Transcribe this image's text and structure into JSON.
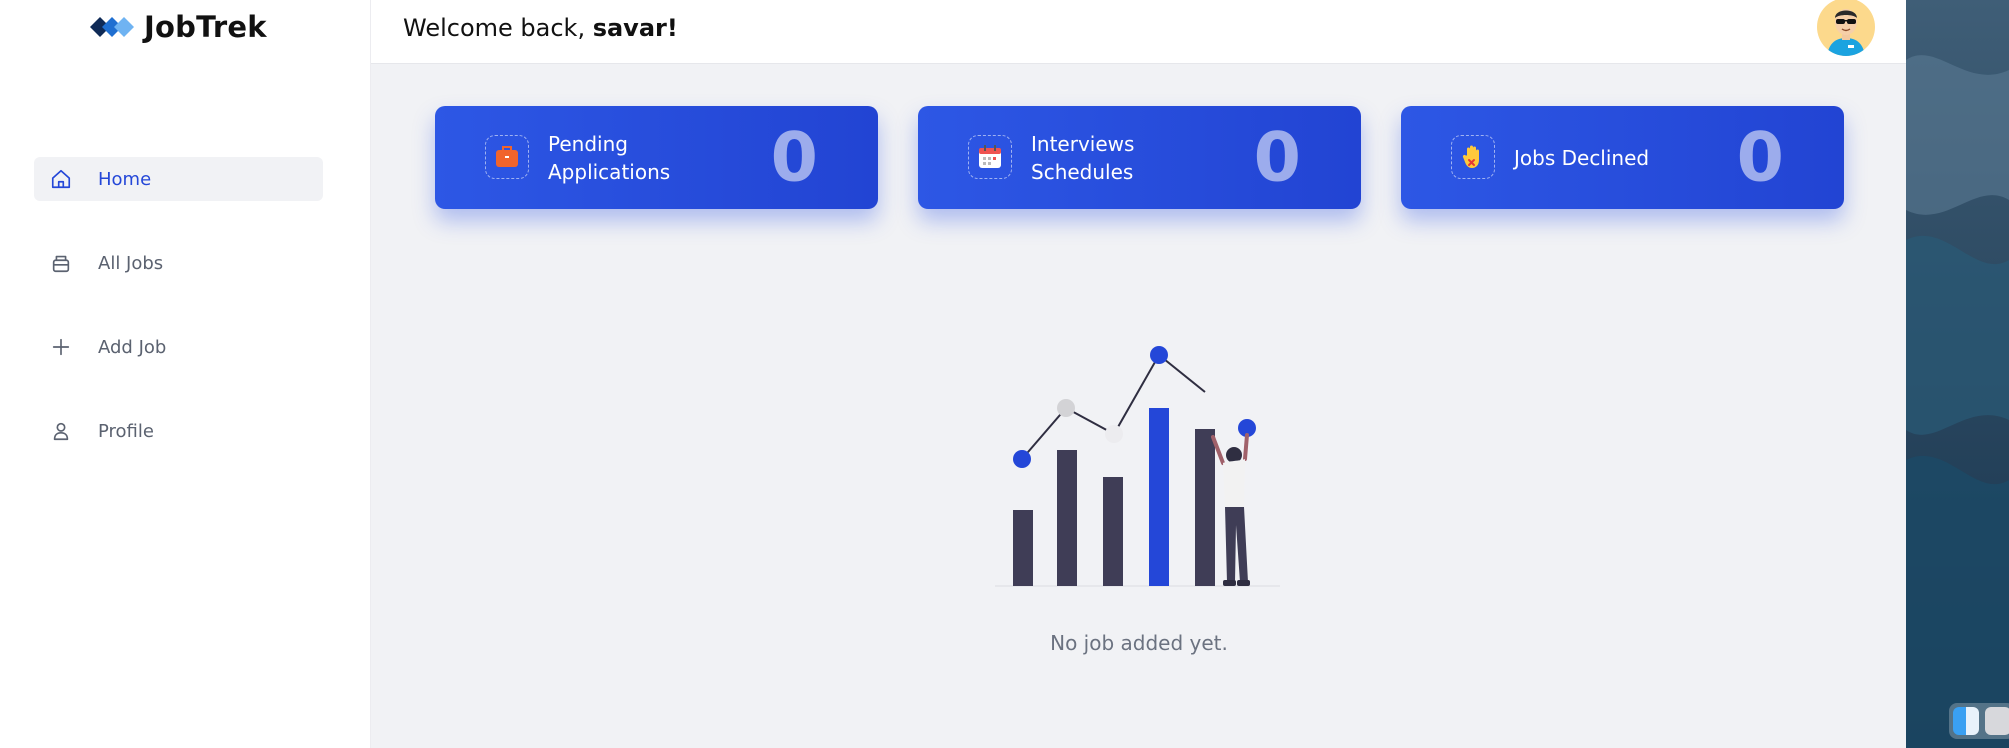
{
  "app": {
    "name": "JobTrek"
  },
  "sidebar": {
    "items": [
      {
        "label": "Home",
        "icon": "home-icon",
        "active": true
      },
      {
        "label": "All Jobs",
        "icon": "briefcase-icon",
        "active": false
      },
      {
        "label": "Add Job",
        "icon": "plus-icon",
        "active": false
      },
      {
        "label": "Profile",
        "icon": "user-icon",
        "active": false
      }
    ]
  },
  "header": {
    "greeting": "Welcome back, ",
    "username": "savar!",
    "avatar_icon": "user-avatar-icon"
  },
  "stats": [
    {
      "label": "Pending Applications",
      "value": "0",
      "icon": "briefcase-icon"
    },
    {
      "label": "Interviews Schedules",
      "value": "0",
      "icon": "calendar-icon"
    },
    {
      "label": "Jobs Declined",
      "value": "0",
      "icon": "stop-hand-icon"
    }
  ],
  "empty_state": {
    "message": "No job added yet."
  },
  "colors": {
    "accent": "#2447d8",
    "card_gradient_start": "#2d57e5",
    "card_gradient_end": "#2244d3",
    "background": "#f1f2f5"
  }
}
